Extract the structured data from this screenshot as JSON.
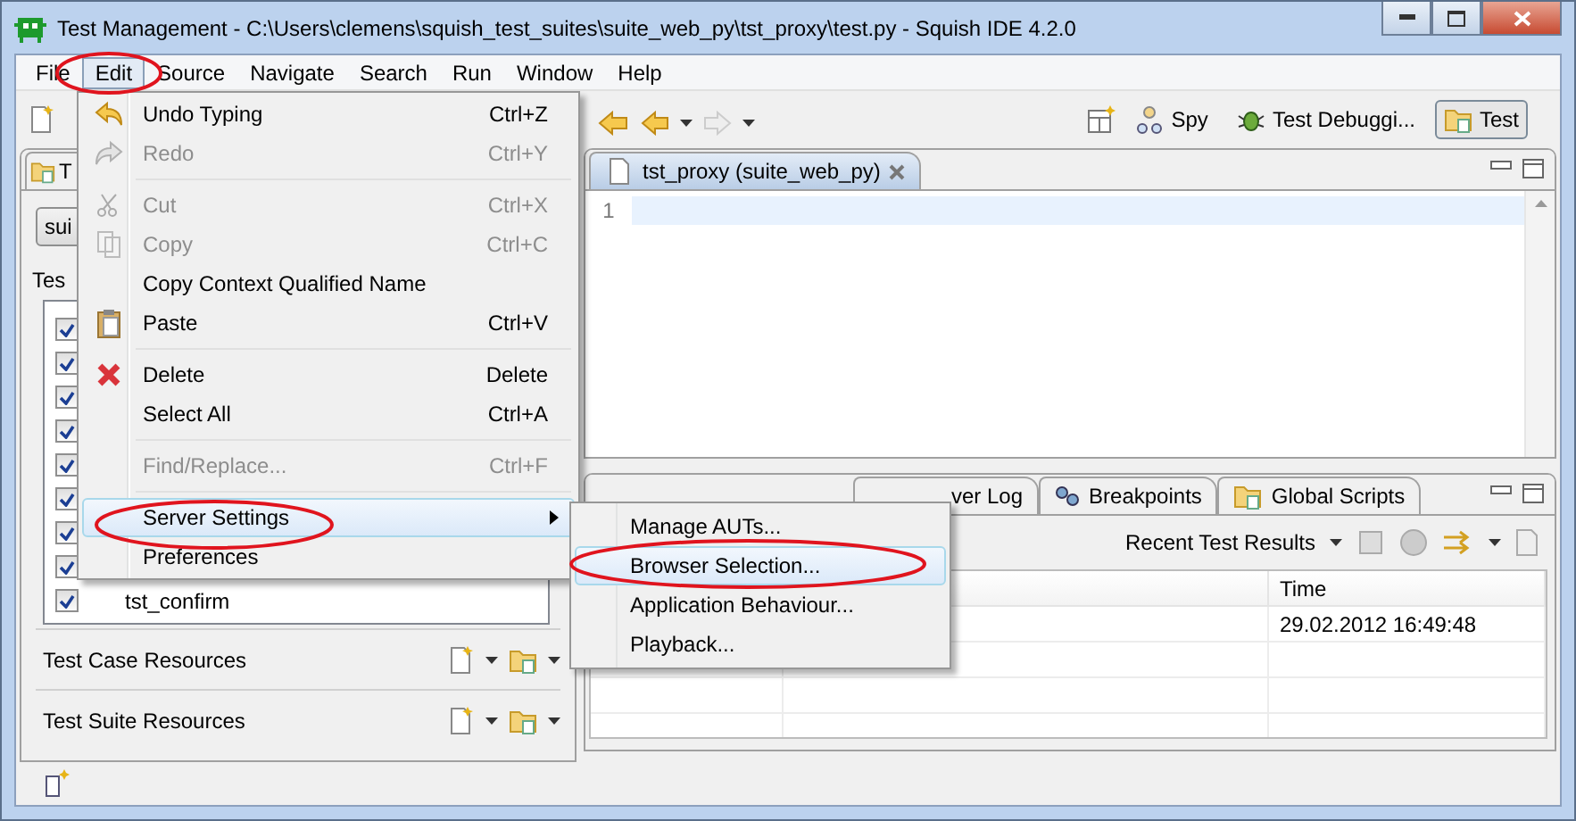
{
  "window": {
    "title": "Test Management - C:\\Users\\clemens\\squish_test_suites\\suite_web_py\\tst_proxy\\test.py - Squish IDE 4.2.0"
  },
  "menu_bar": [
    {
      "label": "File",
      "selected": false
    },
    {
      "label": "Edit",
      "selected": true
    },
    {
      "label": "Source",
      "selected": false
    },
    {
      "label": "Navigate",
      "selected": false
    },
    {
      "label": "Search",
      "selected": false
    },
    {
      "label": "Run",
      "selected": false
    },
    {
      "label": "Window",
      "selected": false
    },
    {
      "label": "Help",
      "selected": false
    }
  ],
  "perspectives": [
    {
      "label": "Spy",
      "selected": false
    },
    {
      "label": "Test Debuggi...",
      "selected": false
    },
    {
      "label": "Test",
      "selected": true
    }
  ],
  "left_panel": {
    "tab": "T",
    "suite_combo": "sui",
    "list_label": "Tes",
    "tree": [
      {
        "checked": true
      },
      {
        "checked": true
      },
      {
        "checked": true
      },
      {
        "checked": true
      },
      {
        "checked": true
      },
      {
        "checked": true
      },
      {
        "checked": true
      },
      {
        "checked": true
      },
      {
        "checked": true,
        "label": "tst_confirm"
      }
    ],
    "sections": [
      "Test Case Resources",
      "Test Suite Resources"
    ]
  },
  "editor": {
    "tab": "tst_proxy (suite_web_py)",
    "line_numbers": [
      "1"
    ]
  },
  "bottom_panel": {
    "tabs": [
      {
        "label": "ver Log",
        "selected": false
      },
      {
        "label": "Breakpoints",
        "selected": false
      },
      {
        "label": "Global Scripts",
        "selected": false
      }
    ],
    "results_dropdown": "Recent Test Results",
    "columns": [
      "Time"
    ],
    "rows": [
      [
        "29.02.2012 16:49:48"
      ]
    ]
  },
  "edit_menu": [
    {
      "kind": "item",
      "label": "Undo Typing",
      "shortcut": "Ctrl+Z",
      "disabled": false
    },
    {
      "kind": "item",
      "label": "Redo",
      "shortcut": "Ctrl+Y",
      "disabled": true
    },
    {
      "kind": "separator"
    },
    {
      "kind": "item",
      "label": "Cut",
      "shortcut": "Ctrl+X",
      "disabled": true
    },
    {
      "kind": "item",
      "label": "Copy",
      "shortcut": "Ctrl+C",
      "disabled": true
    },
    {
      "kind": "item",
      "label": "Copy Context Qualified Name",
      "disabled": false
    },
    {
      "kind": "item",
      "label": "Paste",
      "shortcut": "Ctrl+V",
      "disabled": false
    },
    {
      "kind": "separator"
    },
    {
      "kind": "item",
      "label": "Delete",
      "shortcut": "Delete",
      "disabled": false
    },
    {
      "kind": "item",
      "label": "Select All",
      "shortcut": "Ctrl+A",
      "disabled": false
    },
    {
      "kind": "separator"
    },
    {
      "kind": "item",
      "label": "Find/Replace...",
      "shortcut": "Ctrl+F",
      "disabled": true
    },
    {
      "kind": "separator"
    },
    {
      "kind": "submenu",
      "label": "Server Settings",
      "disabled": false,
      "selected": true
    },
    {
      "kind": "item",
      "label": "Preferences",
      "disabled": false
    }
  ],
  "server_submenu": [
    {
      "label": "Manage AUTs...",
      "selected": false
    },
    {
      "label": "Browser Selection...",
      "selected": true
    },
    {
      "label": "Application Behaviour...",
      "selected": false
    },
    {
      "label": "Playback...",
      "selected": false
    }
  ]
}
